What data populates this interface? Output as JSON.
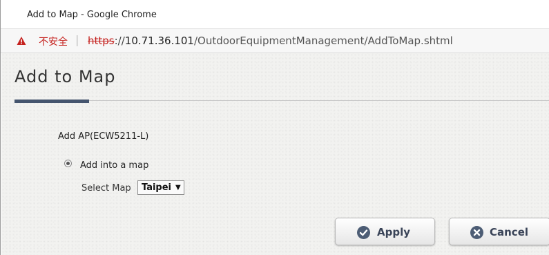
{
  "window": {
    "title": "Add to Map - Google Chrome"
  },
  "address_bar": {
    "security_label": "不安全",
    "separator": "|",
    "url_scheme": "https",
    "url_rest_prefix": "://",
    "url_host": "10.71.36.101",
    "url_path": "/OutdoorEquipmentManagement/AddToMap.shtml"
  },
  "page": {
    "heading": "Add to Map",
    "ap_title": "Add AP(ECW5211-L)",
    "radio_label": "Add into a map",
    "radio_checked": true,
    "select_label": "Select Map",
    "select_value": "Taipei"
  },
  "buttons": {
    "apply_label": "Apply",
    "cancel_label": "Cancel"
  },
  "colors": {
    "accent": "#45556e",
    "warning": "#c5221f",
    "button_icon": "#4d5d75"
  },
  "icons": {
    "warning": "warning-triangle-icon",
    "apply": "check-circle-icon",
    "cancel": "x-circle-icon",
    "dropdown": "dropdown-arrow-icon"
  }
}
